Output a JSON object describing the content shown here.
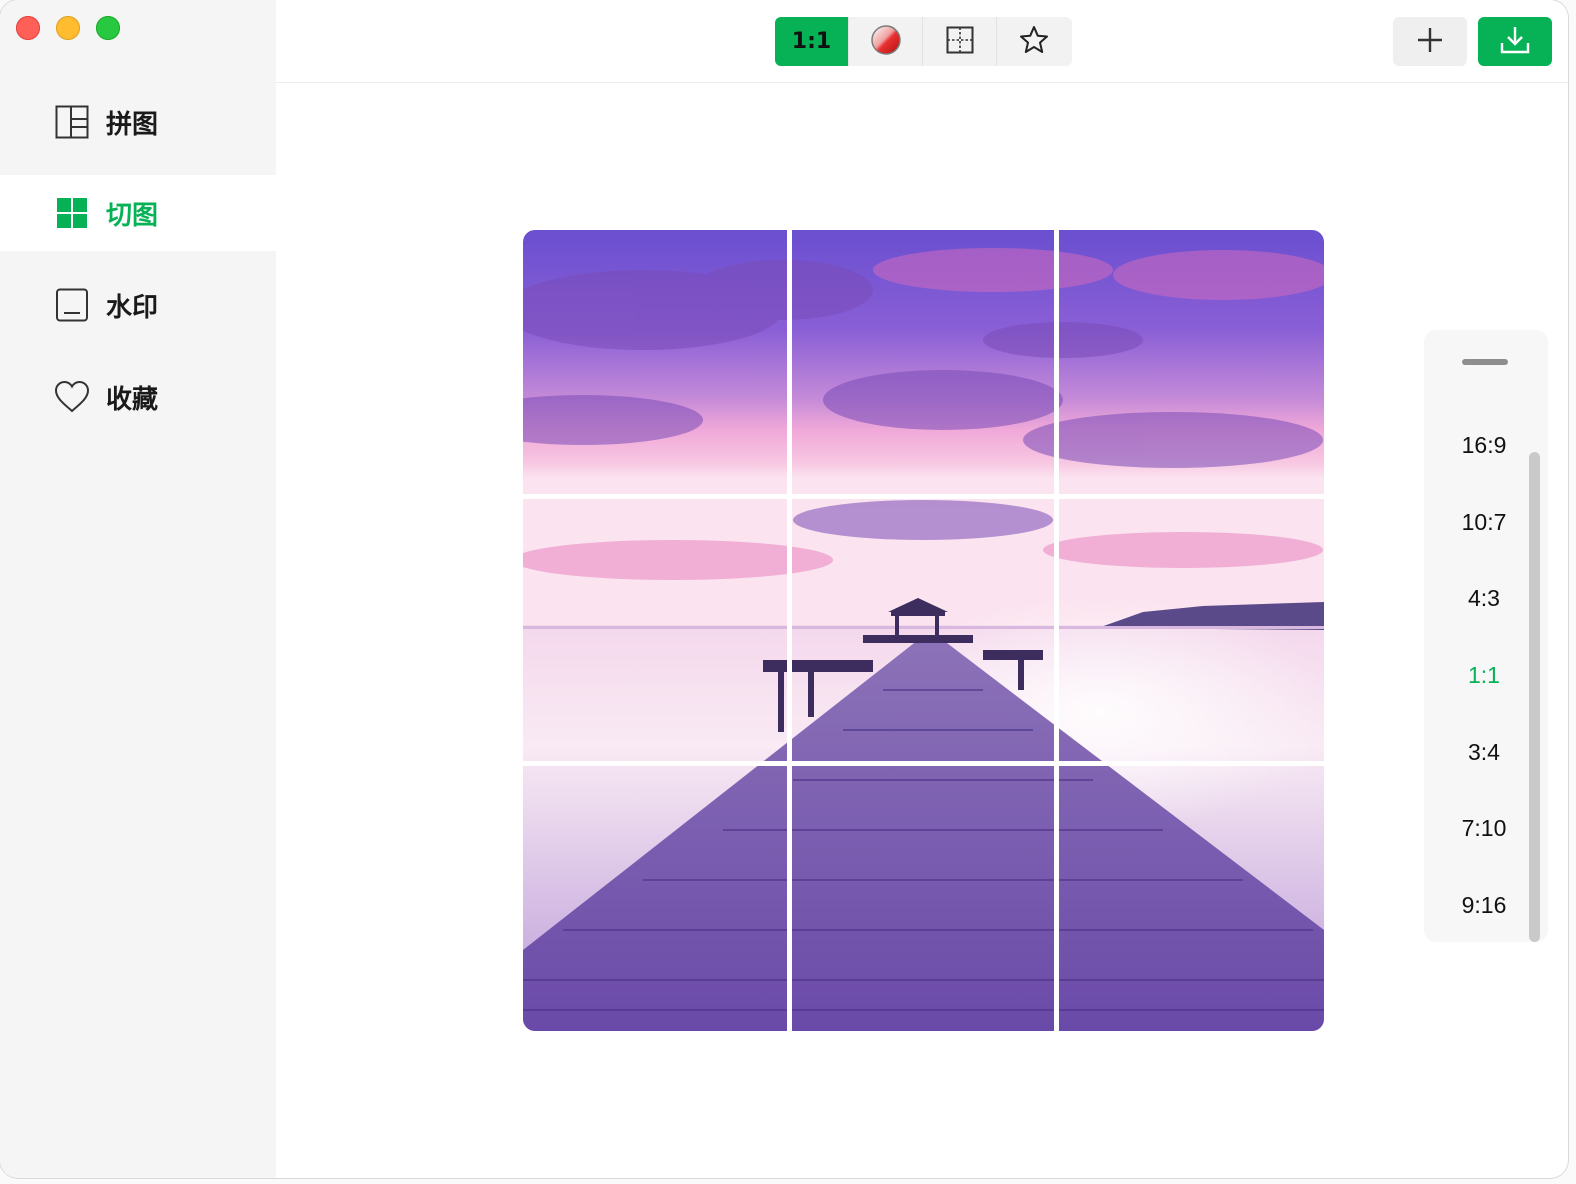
{
  "sidebar": {
    "items": [
      {
        "label": "拼图",
        "icon": "collage-layout-icon",
        "active": false
      },
      {
        "label": "切图",
        "icon": "grid-split-icon",
        "active": true
      },
      {
        "label": "水印",
        "icon": "watermark-icon",
        "active": false
      },
      {
        "label": "收藏",
        "icon": "heart-icon",
        "active": false
      }
    ]
  },
  "toolbar": {
    "aspect_label": "1:1",
    "color_icon": "color-ball-icon",
    "grid_icon": "grid-icon",
    "favorite_icon": "star-icon",
    "add_icon": "plus-icon",
    "download_icon": "download-icon"
  },
  "canvas": {
    "image_description_icon": "pier-sunset-photo",
    "grid": {
      "rows": 3,
      "cols": 3
    }
  },
  "ratio_panel": {
    "options": [
      "16:9",
      "10:7",
      "4:3",
      "1:1",
      "3:4",
      "7:10",
      "9:16"
    ],
    "selected": "1:1"
  },
  "colors": {
    "accent": "#07b257",
    "sidebar_bg": "#f5f5f5"
  }
}
